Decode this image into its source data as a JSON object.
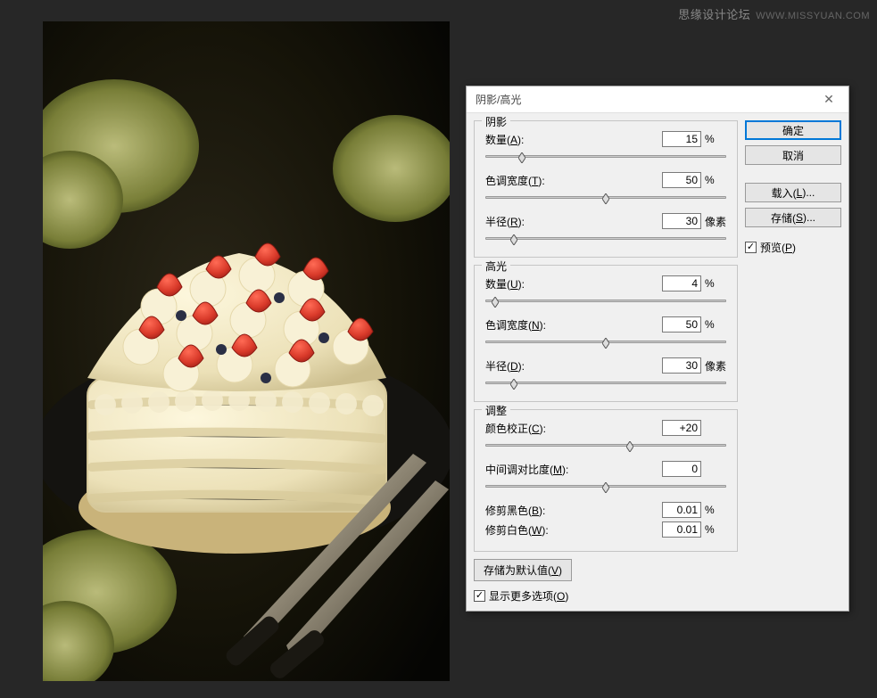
{
  "watermark": {
    "cn": "思缘设计论坛",
    "en": "WWW.MISSYUAN.COM"
  },
  "dialog": {
    "title": "阴影/高光",
    "shadows": {
      "legend": "阴影",
      "amount": {
        "label": "数量(",
        "accel": "A",
        "suffix": "):",
        "value": "15",
        "unit": "%",
        "pct": 15
      },
      "tone": {
        "label": "色调宽度(",
        "accel": "T",
        "suffix": "):",
        "value": "50",
        "unit": "%",
        "pct": 50
      },
      "radius": {
        "label": "半径(",
        "accel": "R",
        "suffix": "):",
        "value": "30",
        "unit": "像素",
        "pct": 12
      }
    },
    "highlights": {
      "legend": "高光",
      "amount": {
        "label": "数量(",
        "accel": "U",
        "suffix": "):",
        "value": "4",
        "unit": "%",
        "pct": 4
      },
      "tone": {
        "label": "色调宽度(",
        "accel": "N",
        "suffix": "):",
        "value": "50",
        "unit": "%",
        "pct": 50
      },
      "radius": {
        "label": "半径(",
        "accel": "D",
        "suffix": "):",
        "value": "30",
        "unit": "像素",
        "pct": 12
      }
    },
    "adjust": {
      "legend": "调整",
      "color": {
        "label": "颜色校正(",
        "accel": "C",
        "suffix": "):",
        "value": "+20",
        "unit": "",
        "pct": 60
      },
      "midtone": {
        "label": "中间调对比度(",
        "accel": "M",
        "suffix": "):",
        "value": "0",
        "unit": "",
        "pct": 50
      },
      "clipblack": {
        "label": "修剪黑色(",
        "accel": "B",
        "suffix": "):",
        "value": "0.01",
        "unit": "%"
      },
      "clipwhite": {
        "label": "修剪白色(",
        "accel": "W",
        "suffix": "):",
        "value": "0.01",
        "unit": "%"
      }
    },
    "save_defaults": {
      "label": "存储为默认值(",
      "accel": "V",
      "suffix": ")"
    },
    "show_more": {
      "label": "显示更多选项(",
      "accel": "O",
      "suffix": ")"
    },
    "buttons": {
      "ok": "确定",
      "cancel": "取消",
      "load": {
        "label": "载入(",
        "accel": "L",
        "suffix": ")..."
      },
      "save": {
        "label": "存储(",
        "accel": "S",
        "suffix": ")..."
      }
    },
    "preview": {
      "label": "预览(",
      "accel": "P",
      "suffix": ")"
    }
  }
}
